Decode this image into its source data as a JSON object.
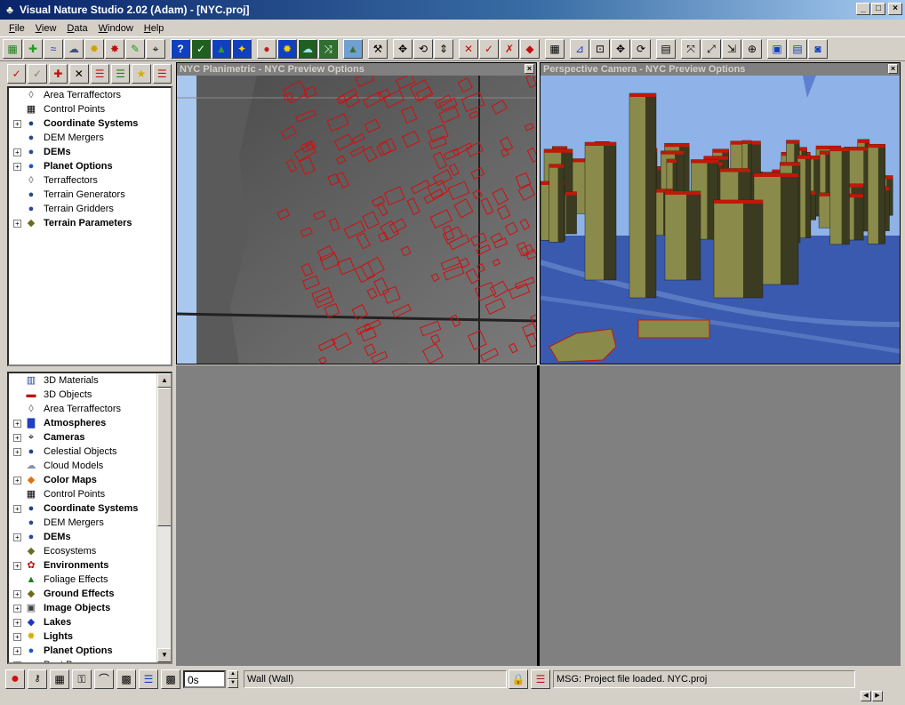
{
  "window": {
    "title": "Visual Nature Studio 2.02  (Adam) - [NYC.proj]"
  },
  "menu": [
    "File",
    "View",
    "Data",
    "Window",
    "Help"
  ],
  "menu_underline": [
    "F",
    "V",
    "D",
    "W",
    "H"
  ],
  "tree_top": [
    {
      "label": "Area Terraffectors",
      "bold": false,
      "expander": false,
      "icon": "area-terraffector-icon",
      "glyph": "◊",
      "color": "#606060"
    },
    {
      "label": "Control Points",
      "bold": false,
      "expander": false,
      "icon": "control-points-icon",
      "glyph": "▦",
      "color": "#000000"
    },
    {
      "label": "Coordinate Systems",
      "bold": true,
      "expander": true,
      "icon": "coordinate-systems-icon",
      "glyph": "●",
      "color": "#1f3f8f"
    },
    {
      "label": "DEM Mergers",
      "bold": false,
      "expander": false,
      "icon": "dem-mergers-icon",
      "glyph": "●",
      "color": "#2a4a8a"
    },
    {
      "label": "DEMs",
      "bold": true,
      "expander": true,
      "icon": "dems-icon",
      "glyph": "●",
      "color": "#2a4a8a"
    },
    {
      "label": "Planet Options",
      "bold": true,
      "expander": true,
      "icon": "planet-options-icon",
      "glyph": "●",
      "color": "#1b56c8"
    },
    {
      "label": "Terraffectors",
      "bold": false,
      "expander": false,
      "icon": "terraffectors-icon",
      "glyph": "◊",
      "color": "#606060"
    },
    {
      "label": "Terrain Generators",
      "bold": false,
      "expander": false,
      "icon": "terrain-generators-icon",
      "glyph": "●",
      "color": "#2a4a8a"
    },
    {
      "label": "Terrain Gridders",
      "bold": false,
      "expander": false,
      "icon": "terrain-gridders-icon",
      "glyph": "●",
      "color": "#2a4a8a"
    },
    {
      "label": "Terrain Parameters",
      "bold": true,
      "expander": true,
      "icon": "terrain-parameters-icon",
      "glyph": "◆",
      "color": "#6b6b1f"
    }
  ],
  "tree_bottom": [
    {
      "label": "3D Materials",
      "bold": false,
      "expander": false,
      "icon": "3d-materials-icon",
      "glyph": "▥",
      "color": "#1f3f8f"
    },
    {
      "label": "3D Objects",
      "bold": false,
      "expander": false,
      "icon": "3d-objects-icon",
      "glyph": "▬",
      "color": "#c01010"
    },
    {
      "label": "Area Terraffectors",
      "bold": false,
      "expander": false,
      "icon": "area-terraffector-icon",
      "glyph": "◊",
      "color": "#606060"
    },
    {
      "label": "Atmospheres",
      "bold": true,
      "expander": true,
      "icon": "atmospheres-icon",
      "glyph": "▇",
      "color": "#2040c0"
    },
    {
      "label": "Cameras",
      "bold": true,
      "expander": true,
      "icon": "cameras-icon",
      "glyph": "⌖",
      "color": "#000000"
    },
    {
      "label": "Celestial Objects",
      "bold": false,
      "expander": true,
      "icon": "celestial-objects-icon",
      "glyph": "●",
      "color": "#1f3f8f"
    },
    {
      "label": "Cloud Models",
      "bold": false,
      "expander": false,
      "icon": "cloud-models-icon",
      "glyph": "☁",
      "color": "#8090b0"
    },
    {
      "label": "Color Maps",
      "bold": true,
      "expander": true,
      "icon": "color-maps-icon",
      "glyph": "◆",
      "color": "#e07010"
    },
    {
      "label": "Control Points",
      "bold": false,
      "expander": false,
      "icon": "control-points-icon",
      "glyph": "▦",
      "color": "#000000"
    },
    {
      "label": "Coordinate Systems",
      "bold": true,
      "expander": true,
      "icon": "coordinate-systems-icon",
      "glyph": "●",
      "color": "#1f3f8f"
    },
    {
      "label": "DEM Mergers",
      "bold": false,
      "expander": false,
      "icon": "dem-mergers-icon",
      "glyph": "●",
      "color": "#2a4a8a"
    },
    {
      "label": "DEMs",
      "bold": true,
      "expander": true,
      "icon": "dems-icon",
      "glyph": "●",
      "color": "#2a4a8a"
    },
    {
      "label": "Ecosystems",
      "bold": false,
      "expander": false,
      "icon": "ecosystems-icon",
      "glyph": "◆",
      "color": "#6b6b1f"
    },
    {
      "label": "Environments",
      "bold": true,
      "expander": true,
      "icon": "environments-icon",
      "glyph": "✿",
      "color": "#c01010"
    },
    {
      "label": "Foliage Effects",
      "bold": false,
      "expander": false,
      "icon": "foliage-effects-icon",
      "glyph": "▲",
      "color": "#1f7f1f"
    },
    {
      "label": "Ground Effects",
      "bold": true,
      "expander": true,
      "icon": "ground-effects-icon",
      "glyph": "◆",
      "color": "#6b6b1f"
    },
    {
      "label": "Image Objects",
      "bold": true,
      "expander": true,
      "icon": "image-objects-icon",
      "glyph": "▣",
      "color": "#404040"
    },
    {
      "label": "Lakes",
      "bold": true,
      "expander": true,
      "icon": "lakes-icon",
      "glyph": "◆",
      "color": "#1b36c8"
    },
    {
      "label": "Lights",
      "bold": true,
      "expander": true,
      "icon": "lights-icon",
      "glyph": "✹",
      "color": "#d0b000"
    },
    {
      "label": "Planet Options",
      "bold": true,
      "expander": true,
      "icon": "planet-options-icon",
      "glyph": "●",
      "color": "#1b56c8"
    },
    {
      "label": "Post Proc...",
      "bold": false,
      "expander": true,
      "icon": "post-process-icon",
      "glyph": "▬",
      "color": "#c0a000"
    }
  ],
  "panes": {
    "planimetric": {
      "title": "NYC Planimetric - NYC Preview Options"
    },
    "perspective": {
      "title": "Perspective Camera - NYC Preview Options"
    }
  },
  "status": {
    "time_value": "0s",
    "object_field": "Wall (Wall)",
    "message": "MSG: Project file loaded. NYC.proj"
  }
}
